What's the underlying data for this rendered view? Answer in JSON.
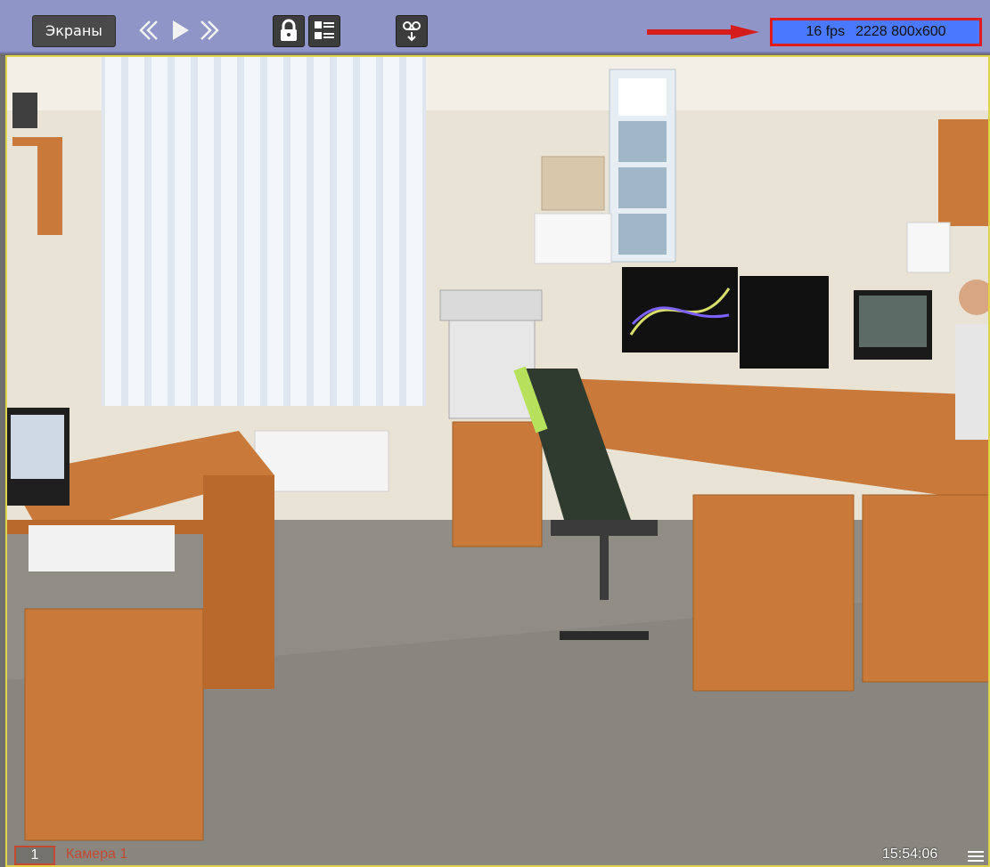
{
  "toolbar": {
    "screens_label": "Экраны",
    "icons": {
      "rewind": "double-left-chevron",
      "play": "play-triangle",
      "forward": "double-right-chevron",
      "lock": "lock-icon",
      "list": "list-icon",
      "record": "record-icon"
    }
  },
  "info": {
    "fps_text": "16 fps",
    "resolution_text": "2228 800x600"
  },
  "video": {
    "camera_number": "1",
    "camera_name": "Камера 1",
    "time": "15:54:06"
  },
  "colors": {
    "toolbar_bg": "#8f95c6",
    "info_bg": "#4a79ff",
    "info_border": "#e11b1b",
    "frame_border": "#e0d34a",
    "camera_label": "#c24a31"
  }
}
